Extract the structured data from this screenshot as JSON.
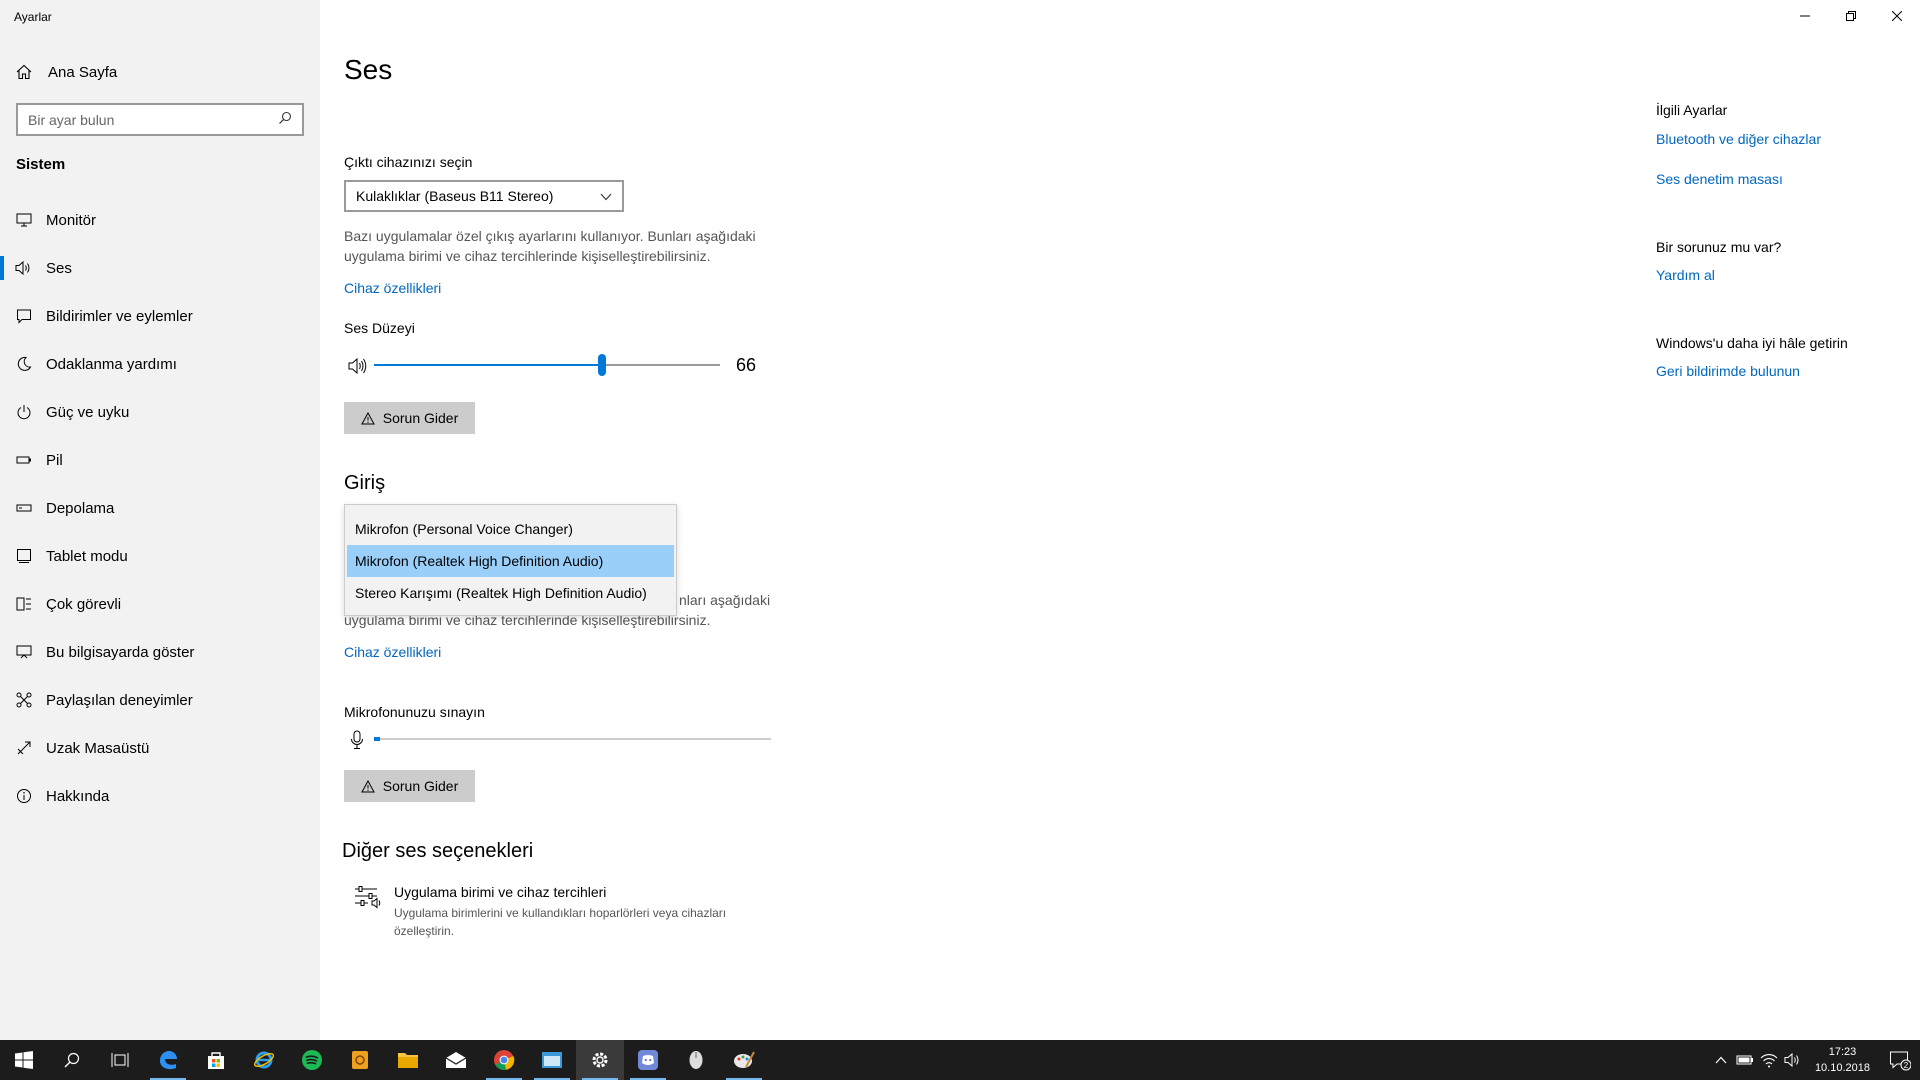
{
  "window": {
    "title": "Ayarlar"
  },
  "sidebar": {
    "home_label": "Ana Sayfa",
    "search_placeholder": "Bir ayar bulun",
    "section_label": "Sistem",
    "items": [
      {
        "label": "Monitör",
        "icon": "monitor-icon"
      },
      {
        "label": "Ses",
        "icon": "speaker-icon",
        "active": true
      },
      {
        "label": "Bildirimler ve eylemler",
        "icon": "notification-icon"
      },
      {
        "label": "Odaklanma yardımı",
        "icon": "moon-icon"
      },
      {
        "label": "Güç ve uyku",
        "icon": "power-icon"
      },
      {
        "label": "Pil",
        "icon": "battery-icon"
      },
      {
        "label": "Depolama",
        "icon": "storage-icon"
      },
      {
        "label": "Tablet modu",
        "icon": "tablet-icon"
      },
      {
        "label": "Çok görevli",
        "icon": "multitask-icon"
      },
      {
        "label": "Bu bilgisayarda göster",
        "icon": "project-icon"
      },
      {
        "label": "Paylaşılan deneyimler",
        "icon": "shared-icon"
      },
      {
        "label": "Uzak Masaüstü",
        "icon": "remote-icon"
      },
      {
        "label": "Hakkında",
        "icon": "info-icon"
      }
    ]
  },
  "main": {
    "title": "Ses",
    "output": {
      "label": "Çıktı cihazınızı seçin",
      "selected": "Kulaklıklar (Baseus B11 Stereo)",
      "description": "Bazı uygulamalar özel çıkış ayarlarını kullanıyor. Bunları aşağıdaki uygulama birimi ve cihaz tercihlerinde kişiselleştirebilirsiniz.",
      "device_properties": "Cihaz özellikleri",
      "volume_label": "Ses Düzeyi",
      "volume_value": "66",
      "volume_fraction": 0.66,
      "troubleshoot": "Sorun Gider"
    },
    "input": {
      "heading": "Giriş",
      "options": [
        "Mikrofon (Personal Voice Changer)",
        "Mikrofon (Realtek High Definition Audio)",
        "Stereo Karışımı (Realtek High Definition Audio)"
      ],
      "selected_index": 1,
      "description_tail_1": "nları aşağıdaki",
      "description_tail_2": "uygulama birimi ve cihaz tercihlerinde kişiselleştirebilirsiniz.",
      "device_properties": "Cihaz özellikleri",
      "mic_test_label": "Mikrofonunuzu sınayın",
      "mic_level_fraction": 0.01,
      "troubleshoot": "Sorun Gider"
    },
    "other": {
      "heading": "Diğer ses seçenekleri",
      "option_title": "Uygulama birimi ve cihaz tercihleri",
      "option_desc": "Uygulama birimlerini ve kullandıkları hoparlörleri veya cihazları özelleştirin."
    }
  },
  "related": {
    "heading": "İlgili Ayarlar",
    "links": [
      "Bluetooth ve diğer cihazlar",
      "Ses denetim masası"
    ],
    "question_heading": "Bir sorunuz mu var?",
    "help_link": "Yardım al",
    "feedback_heading": "Windows'u daha iyi hâle getirin",
    "feedback_link": "Geri bildirimde bulunun"
  },
  "taskbar": {
    "time": "17:23",
    "date": "10.10.2018",
    "notification_count": "2",
    "accent": "#0078d7"
  }
}
